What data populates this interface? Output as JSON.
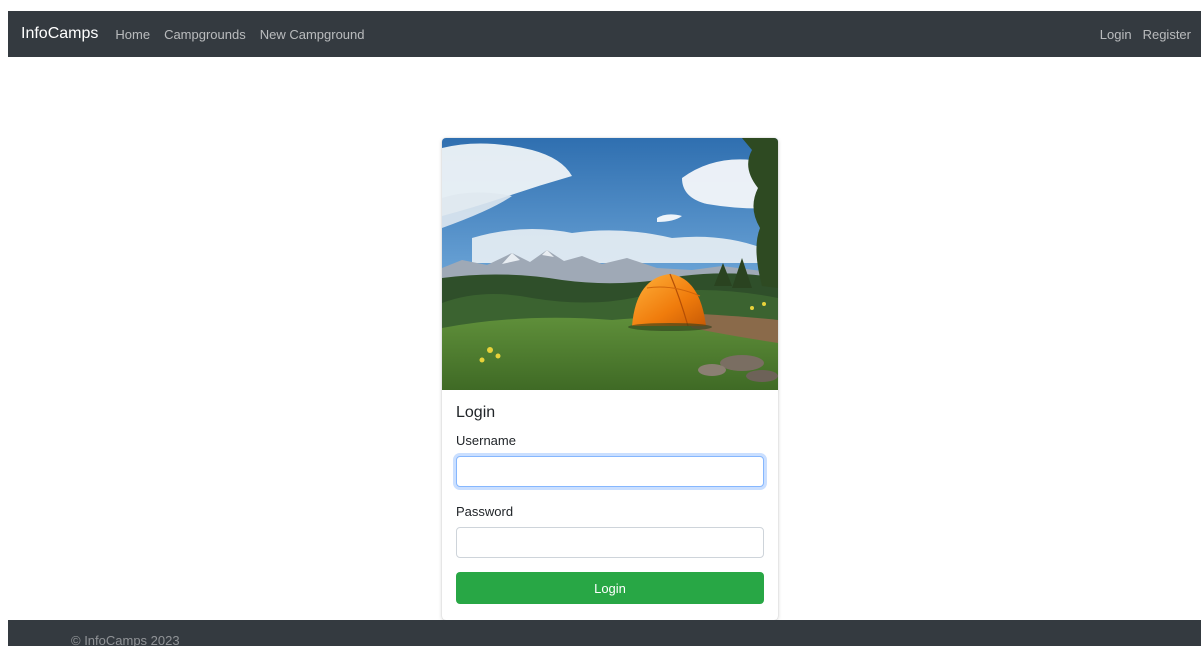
{
  "navbar": {
    "brand": "InfoCamps",
    "left_links": [
      "Home",
      "Campgrounds",
      "New Campground"
    ],
    "right_links": [
      "Login",
      "Register"
    ],
    "background": "#343a40"
  },
  "login_card": {
    "image_icon": "camping-tent-landscape-photo",
    "title": "Login",
    "username_label": "Username",
    "username_value": "",
    "password_label": "Password",
    "password_value": "",
    "submit_label": "Login",
    "submit_color": "#28a745"
  },
  "footer": {
    "text": "© InfoCamps 2023"
  }
}
